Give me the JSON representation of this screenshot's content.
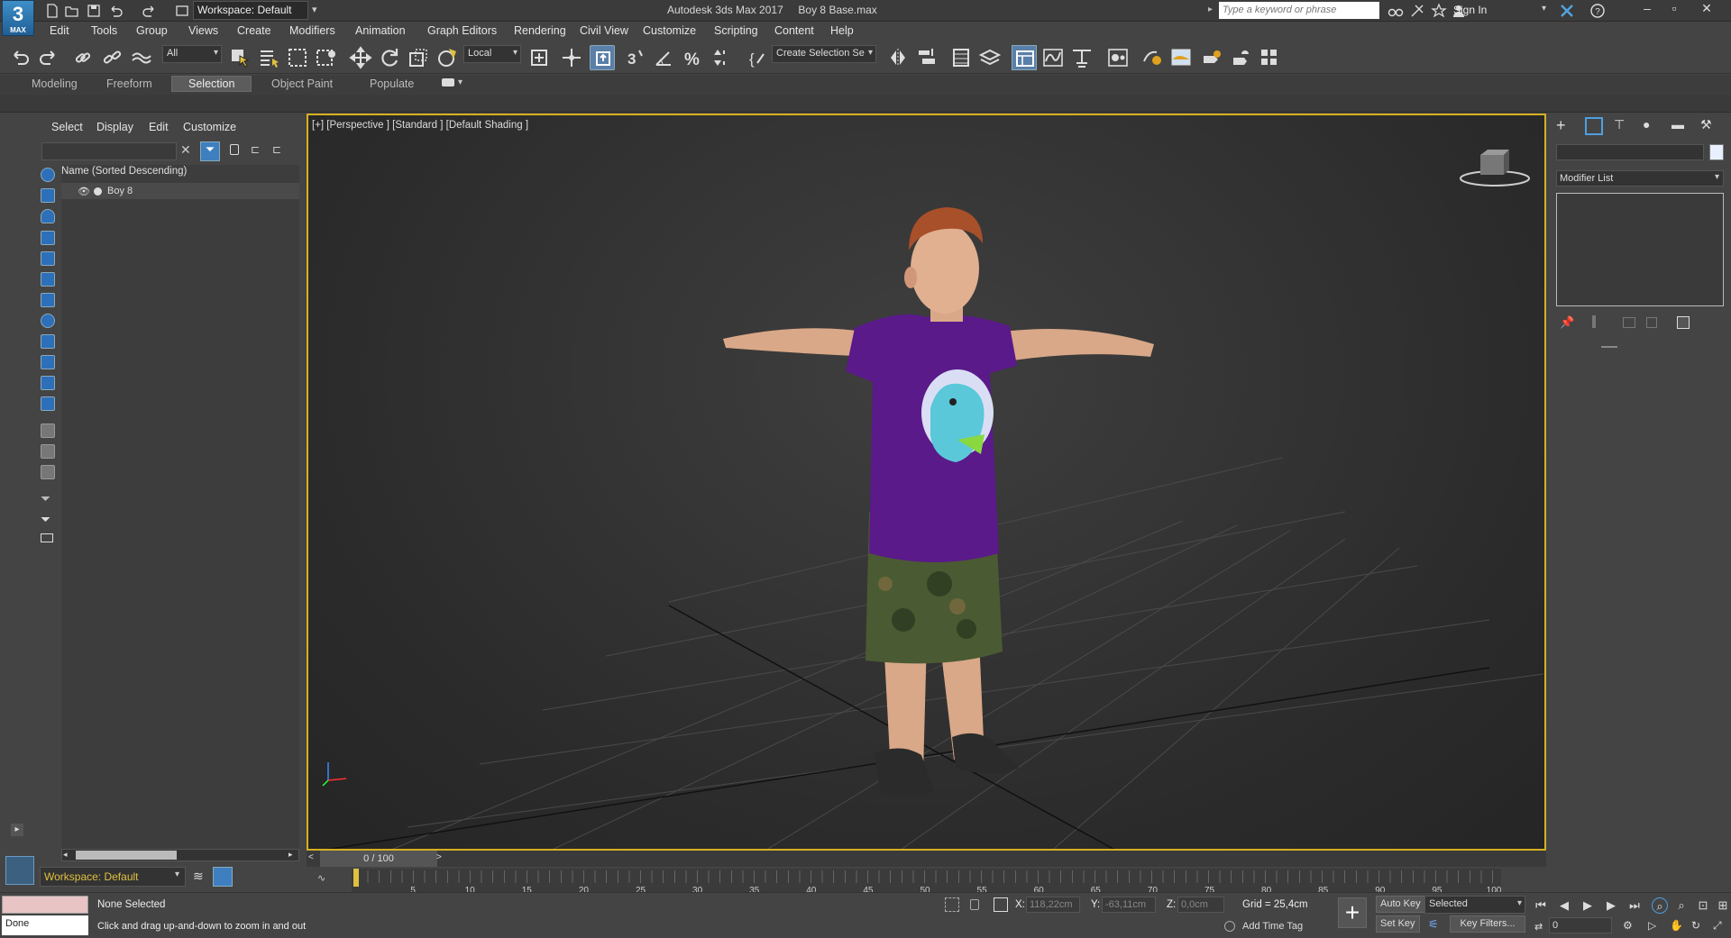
{
  "app": {
    "title": "Autodesk 3ds Max 2017",
    "file": "Boy 8 Base.max",
    "logo_number": "3",
    "logo_text": "MAX"
  },
  "titlebar": {
    "workspace": "Workspace: Default",
    "search_placeholder": "Type a keyword or phrase",
    "sign_in": "Sign In"
  },
  "menu": [
    "Edit",
    "Tools",
    "Group",
    "Views",
    "Create",
    "Modifiers",
    "Animation",
    "Graph Editors",
    "Rendering",
    "Civil View",
    "Customize",
    "Scripting",
    "Content",
    "Help"
  ],
  "toolbar": {
    "selection_filter": "All",
    "reference_coord": "Local",
    "named_selection": "Create Selection Se"
  },
  "ribbon": {
    "tabs": [
      "Modeling",
      "Freeform",
      "Selection",
      "Object Paint",
      "Populate"
    ],
    "active_tab": "Selection"
  },
  "explorer": {
    "tabs": [
      "Select",
      "Display",
      "Edit",
      "Customize"
    ],
    "column_header": "Name (Sorted Descending)",
    "rows": [
      {
        "label": "Boy 8"
      }
    ],
    "workspace": "Workspace: Default"
  },
  "viewport": {
    "label": "[+] [Perspective ] [Standard ] [Default Shading ]"
  },
  "command_panel": {
    "modifier_list": "Modifier List"
  },
  "timeline": {
    "frame_display": "0 / 100",
    "ticks": [
      "5",
      "10",
      "15",
      "20",
      "25",
      "30",
      "35",
      "40",
      "45",
      "50",
      "55",
      "60",
      "65",
      "70",
      "75",
      "80",
      "85",
      "90",
      "95",
      "100"
    ]
  },
  "status": {
    "maxscript_result": "Done",
    "selection": "None Selected",
    "prompt": "Click and drag up-and-down to zoom in and out",
    "x_label": "X:",
    "x_value": "118,22cm",
    "y_label": "Y:",
    "y_value": "-63,11cm",
    "z_label": "Z:",
    "z_value": "0,0cm",
    "grid": "Grid = 25,4cm",
    "add_time_tag": "Add Time Tag",
    "auto_key": "Auto Key",
    "set_key": "Set Key",
    "key_mode": "Selected",
    "key_filters": "Key Filters...",
    "current_frame": "0"
  },
  "colors": {
    "viewport_border": "#d6b020",
    "accent_blue": "#2d6fb8",
    "shirt": "#5a1a8a"
  }
}
